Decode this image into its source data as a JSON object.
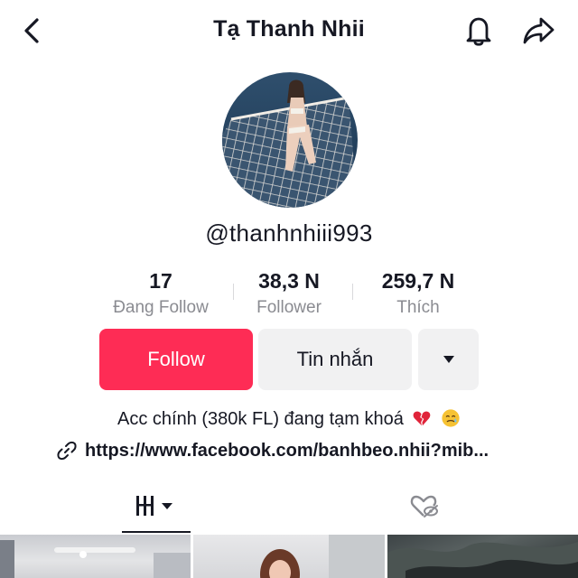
{
  "header": {
    "title": "Tạ Thanh Nhii",
    "back_icon": "chevron-left-icon",
    "bell_icon": "bell-icon",
    "share_icon": "share-arrow-icon"
  },
  "profile": {
    "username": "@thanhnhiii993",
    "avatar_icon": "profile-avatar"
  },
  "stats": [
    {
      "value": "17",
      "label": "Đang Follow"
    },
    {
      "value": "38,3 N",
      "label": "Follower"
    },
    {
      "value": "259,7 N",
      "label": "Thích"
    }
  ],
  "actions": {
    "follow_label": "Follow",
    "message_label": "Tin nhắn",
    "more_icon": "caret-down-icon"
  },
  "bio": {
    "text": "Acc chính (380k FL) đang tạm khoá",
    "emojis": [
      "broken-heart-icon",
      "crying-smile-icon"
    ],
    "link": "https://www.facebook.com/banhbeo.nhii?mib..."
  },
  "tabs": [
    {
      "icon": "video-grid-icon",
      "active": true
    },
    {
      "icon": "liked-hidden-icon",
      "active": false
    }
  ],
  "colors": {
    "accent": "#fe2c55",
    "text": "#161823",
    "muted": "#8a8b91",
    "button_bg": "#f1f1f2"
  }
}
